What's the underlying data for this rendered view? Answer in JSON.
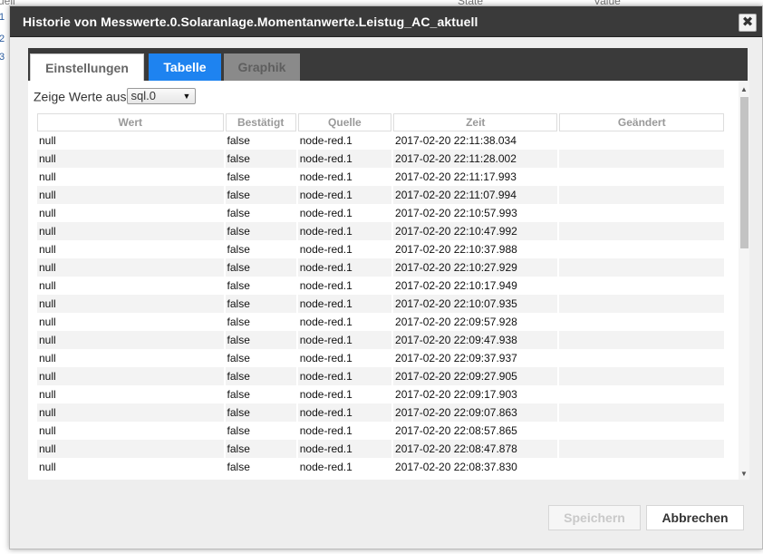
{
  "background": {
    "header_left": "uell",
    "header_state": "State",
    "header_value": "Value",
    "left_markers": [
      "1",
      "2",
      "3"
    ]
  },
  "dialog": {
    "title": "Historie von Messwerte.0.Solaranlage.Momentanwerte.Leistug_AC_aktuell",
    "close_icon": "✖"
  },
  "tabs": [
    {
      "label": "Einstellungen",
      "state": "inactive"
    },
    {
      "label": "Tabelle",
      "state": "active"
    },
    {
      "label": "Graphik",
      "state": "disabled"
    }
  ],
  "source_select": {
    "label": "Zeige Werte aus",
    "value": "sql.0"
  },
  "table": {
    "columns": [
      "Wert",
      "Bestätigt",
      "Quelle",
      "Zeit",
      "Geändert"
    ],
    "rows": [
      [
        "null",
        "false",
        "node-red.1",
        "2017-02-20 22:11:38.034",
        ""
      ],
      [
        "null",
        "false",
        "node-red.1",
        "2017-02-20 22:11:28.002",
        ""
      ],
      [
        "null",
        "false",
        "node-red.1",
        "2017-02-20 22:11:17.993",
        ""
      ],
      [
        "null",
        "false",
        "node-red.1",
        "2017-02-20 22:11:07.994",
        ""
      ],
      [
        "null",
        "false",
        "node-red.1",
        "2017-02-20 22:10:57.993",
        ""
      ],
      [
        "null",
        "false",
        "node-red.1",
        "2017-02-20 22:10:47.992",
        ""
      ],
      [
        "null",
        "false",
        "node-red.1",
        "2017-02-20 22:10:37.988",
        ""
      ],
      [
        "null",
        "false",
        "node-red.1",
        "2017-02-20 22:10:27.929",
        ""
      ],
      [
        "null",
        "false",
        "node-red.1",
        "2017-02-20 22:10:17.949",
        ""
      ],
      [
        "null",
        "false",
        "node-red.1",
        "2017-02-20 22:10:07.935",
        ""
      ],
      [
        "null",
        "false",
        "node-red.1",
        "2017-02-20 22:09:57.928",
        ""
      ],
      [
        "null",
        "false",
        "node-red.1",
        "2017-02-20 22:09:47.938",
        ""
      ],
      [
        "null",
        "false",
        "node-red.1",
        "2017-02-20 22:09:37.937",
        ""
      ],
      [
        "null",
        "false",
        "node-red.1",
        "2017-02-20 22:09:27.905",
        ""
      ],
      [
        "null",
        "false",
        "node-red.1",
        "2017-02-20 22:09:17.903",
        ""
      ],
      [
        "null",
        "false",
        "node-red.1",
        "2017-02-20 22:09:07.863",
        ""
      ],
      [
        "null",
        "false",
        "node-red.1",
        "2017-02-20 22:08:57.865",
        ""
      ],
      [
        "null",
        "false",
        "node-red.1",
        "2017-02-20 22:08:47.878",
        ""
      ],
      [
        "null",
        "false",
        "node-red.1",
        "2017-02-20 22:08:37.830",
        ""
      ]
    ]
  },
  "buttons": {
    "save": "Speichern",
    "cancel": "Abbrechen"
  },
  "colors": {
    "active_tab": "#1e83f0",
    "titlebar": "#3a3a3a"
  }
}
